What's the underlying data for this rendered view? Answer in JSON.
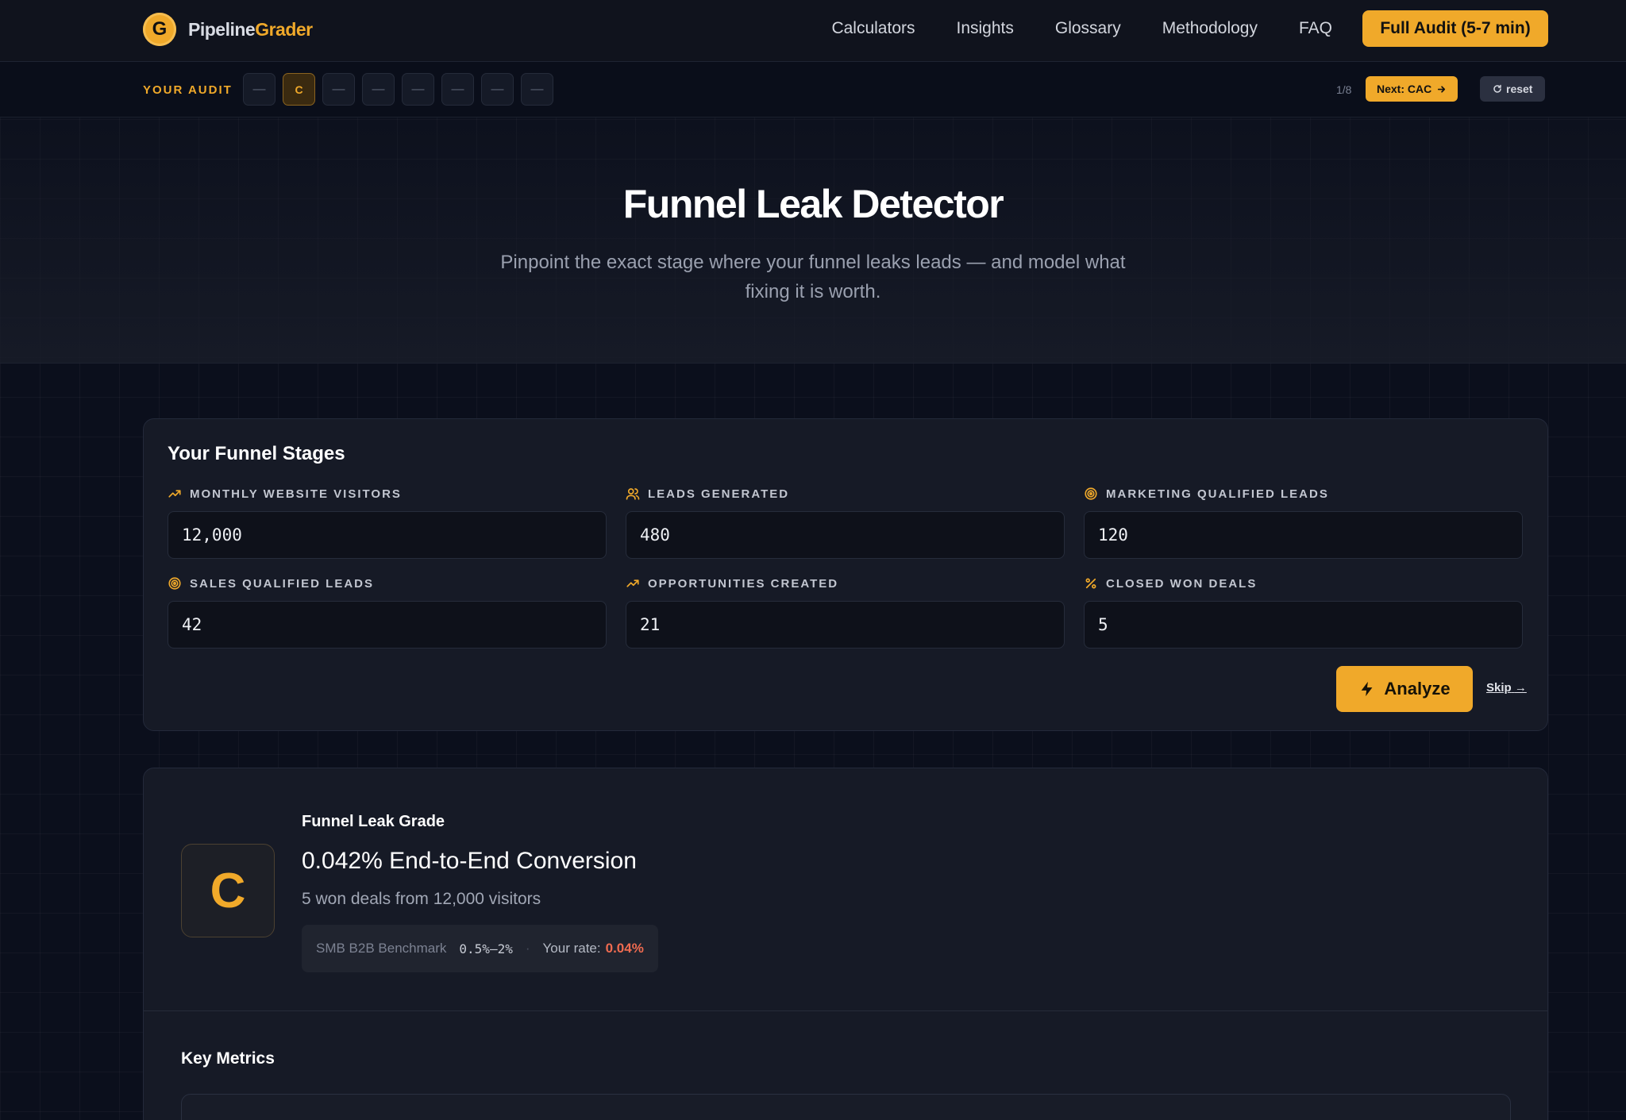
{
  "brand": {
    "mark": "G",
    "name_a": "Pipeline",
    "name_b": "Grader"
  },
  "nav": {
    "links": [
      "Calculators",
      "Insights",
      "Glossary",
      "Methodology",
      "FAQ"
    ],
    "cta": "Full Audit (5-7 min)"
  },
  "audit": {
    "label": "YOUR AUDIT",
    "slots": [
      "—",
      "C",
      "—",
      "—",
      "—",
      "—",
      "—",
      "—"
    ],
    "active_index": 1,
    "step": "1/8",
    "next": "Next: CAC",
    "reset": "reset"
  },
  "hero": {
    "title": "Funnel Leak Detector",
    "subtitle": "Pinpoint the exact stage where your funnel leaks leads — and model what fixing it is worth."
  },
  "funnel": {
    "title": "Your Funnel Stages",
    "fields": [
      {
        "label": "MONTHLY WEBSITE VISITORS",
        "value": "12,000",
        "icon": "trending-up-icon"
      },
      {
        "label": "LEADS GENERATED",
        "value": "480",
        "icon": "users-icon"
      },
      {
        "label": "MARKETING QUALIFIED LEADS",
        "value": "120",
        "icon": "target-icon"
      },
      {
        "label": "SALES QUALIFIED LEADS",
        "value": "42",
        "icon": "target-icon"
      },
      {
        "label": "OPPORTUNITIES CREATED",
        "value": "21",
        "icon": "trending-up-icon"
      },
      {
        "label": "CLOSED WON DEALS",
        "value": "5",
        "icon": "percent-icon"
      }
    ],
    "analyze": "Analyze",
    "skip": "Skip"
  },
  "grade": {
    "letter": "C",
    "eyebrow": "Funnel Leak Grade",
    "headline": "0.042% End-to-End Conversion",
    "sub": "5 won deals from 12,000 visitors",
    "bench_label": "SMB B2B Benchmark",
    "bench_value": "0.5%–2%",
    "rate_label": "Your rate:",
    "rate_value": "0.04%",
    "key_metrics": "Key Metrics"
  },
  "colors": {
    "accent": "#f0a92a",
    "bad": "#ef6b50",
    "bg": "#0b0f1c",
    "card": "#161a26"
  }
}
